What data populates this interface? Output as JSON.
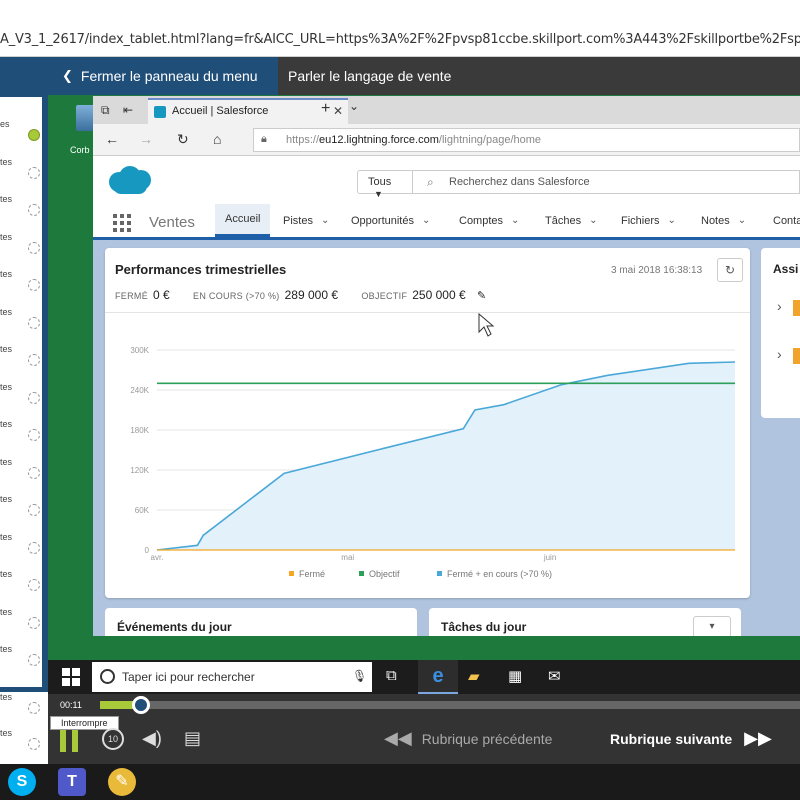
{
  "browser": {
    "url": "A_V3_1_2617/index_tablet.html?lang=fr&AICC_URL=https%3A%2F%2Fpvsp81ccbe.skillport.com%3A443%2Fskillportbe%2Fsp"
  },
  "course": {
    "menu_toggle_label": "Fermer le panneau du menu",
    "title": "Parler le langage de vente"
  },
  "sidebar": {
    "items": [
      {
        "label": "es",
        "done": true
      },
      {
        "label": "tes",
        "done": false
      },
      {
        "label": "tes",
        "done": false
      },
      {
        "label": "tes",
        "done": false
      },
      {
        "label": "tes",
        "done": false
      },
      {
        "label": "tes",
        "done": false
      },
      {
        "label": "tes",
        "done": false
      },
      {
        "label": "tes",
        "done": false
      },
      {
        "label": "tes",
        "done": false
      },
      {
        "label": "tes",
        "done": false
      },
      {
        "label": "tes",
        "done": false
      },
      {
        "label": "tes",
        "done": false
      },
      {
        "label": "tes",
        "done": false
      },
      {
        "label": "tes",
        "done": false
      },
      {
        "label": "tes",
        "done": false
      },
      {
        "label": "tes",
        "done": false
      },
      {
        "label": "tes",
        "done": false
      }
    ]
  },
  "desktop": {
    "recycle_bin_label": "Corb"
  },
  "edge": {
    "tab_title": "Accueil | Salesforce",
    "tab_close": "✕",
    "new_tab": "+",
    "tab_menu": "⌄",
    "address_prefix": "https://",
    "address_domain": "eu12.lightning.force.com",
    "address_path": "/lightning/page/home"
  },
  "salesforce": {
    "scope_label": "Tous",
    "search_placeholder": "Recherchez dans Salesforce",
    "app_name": "Ventes",
    "nav": [
      "Accueil",
      "Pistes",
      "Opportunités",
      "Comptes",
      "Tâches",
      "Fichiers",
      "Notes",
      "Conta"
    ],
    "card": {
      "title": "Performances trimestrielles",
      "date": "3 mai 2018 16:38:13",
      "closed_label": "FERMÉ",
      "closed_value": "0 €",
      "open_label": "EN COURS (>70 %)",
      "open_value": "289 000 €",
      "goal_label": "OBJECTIF",
      "goal_value": "250 000 €"
    },
    "assistant_title": "Assi",
    "events_title": "Événements du jour",
    "tasks_title": "Tâches du jour"
  },
  "taskbar": {
    "search_placeholder": "Taper ici pour rechercher"
  },
  "player": {
    "time": "00:11",
    "progress": 0.045,
    "tooltip": "Interrompre",
    "replay_label": "10",
    "prev_label": "Rubrique précédente",
    "next_label": "Rubrique suivante"
  },
  "colors": {
    "course_blue": "#1f4e79",
    "progress_green": "#a8c93a",
    "desktop_green": "#1e7a3c",
    "series_closed": "#f5a623",
    "series_goal": "#2ca05a",
    "series_open": "#4aa8d8"
  },
  "chart_data": {
    "type": "area",
    "x_ticks": [
      "avr.",
      "mai",
      "juin"
    ],
    "y_ticks": [
      "0",
      "60K",
      "120K",
      "180K",
      "240K",
      "300K"
    ],
    "ylim": [
      0,
      300000
    ],
    "grid": true,
    "legend_position": "bottom",
    "legend": [
      "Fermé",
      "Objectif",
      "Fermé + en cours (>70 %)"
    ],
    "goal": 250000,
    "series": [
      {
        "name": "Fermé + en cours (>70 %)",
        "x": [
          0,
          0.07,
          0.08,
          0.22,
          0.39,
          0.53,
          0.55,
          0.6,
          0.7,
          0.78,
          0.92,
          1.0
        ],
        "values": [
          0,
          7000,
          22000,
          115000,
          152000,
          182000,
          210000,
          218000,
          248000,
          262000,
          280000,
          282000
        ]
      },
      {
        "name": "Objectif",
        "x": [
          0,
          1.0
        ],
        "values": [
          250000,
          250000
        ]
      },
      {
        "name": "Fermé",
        "x": [
          0,
          1.0
        ],
        "values": [
          0,
          0
        ]
      }
    ]
  }
}
